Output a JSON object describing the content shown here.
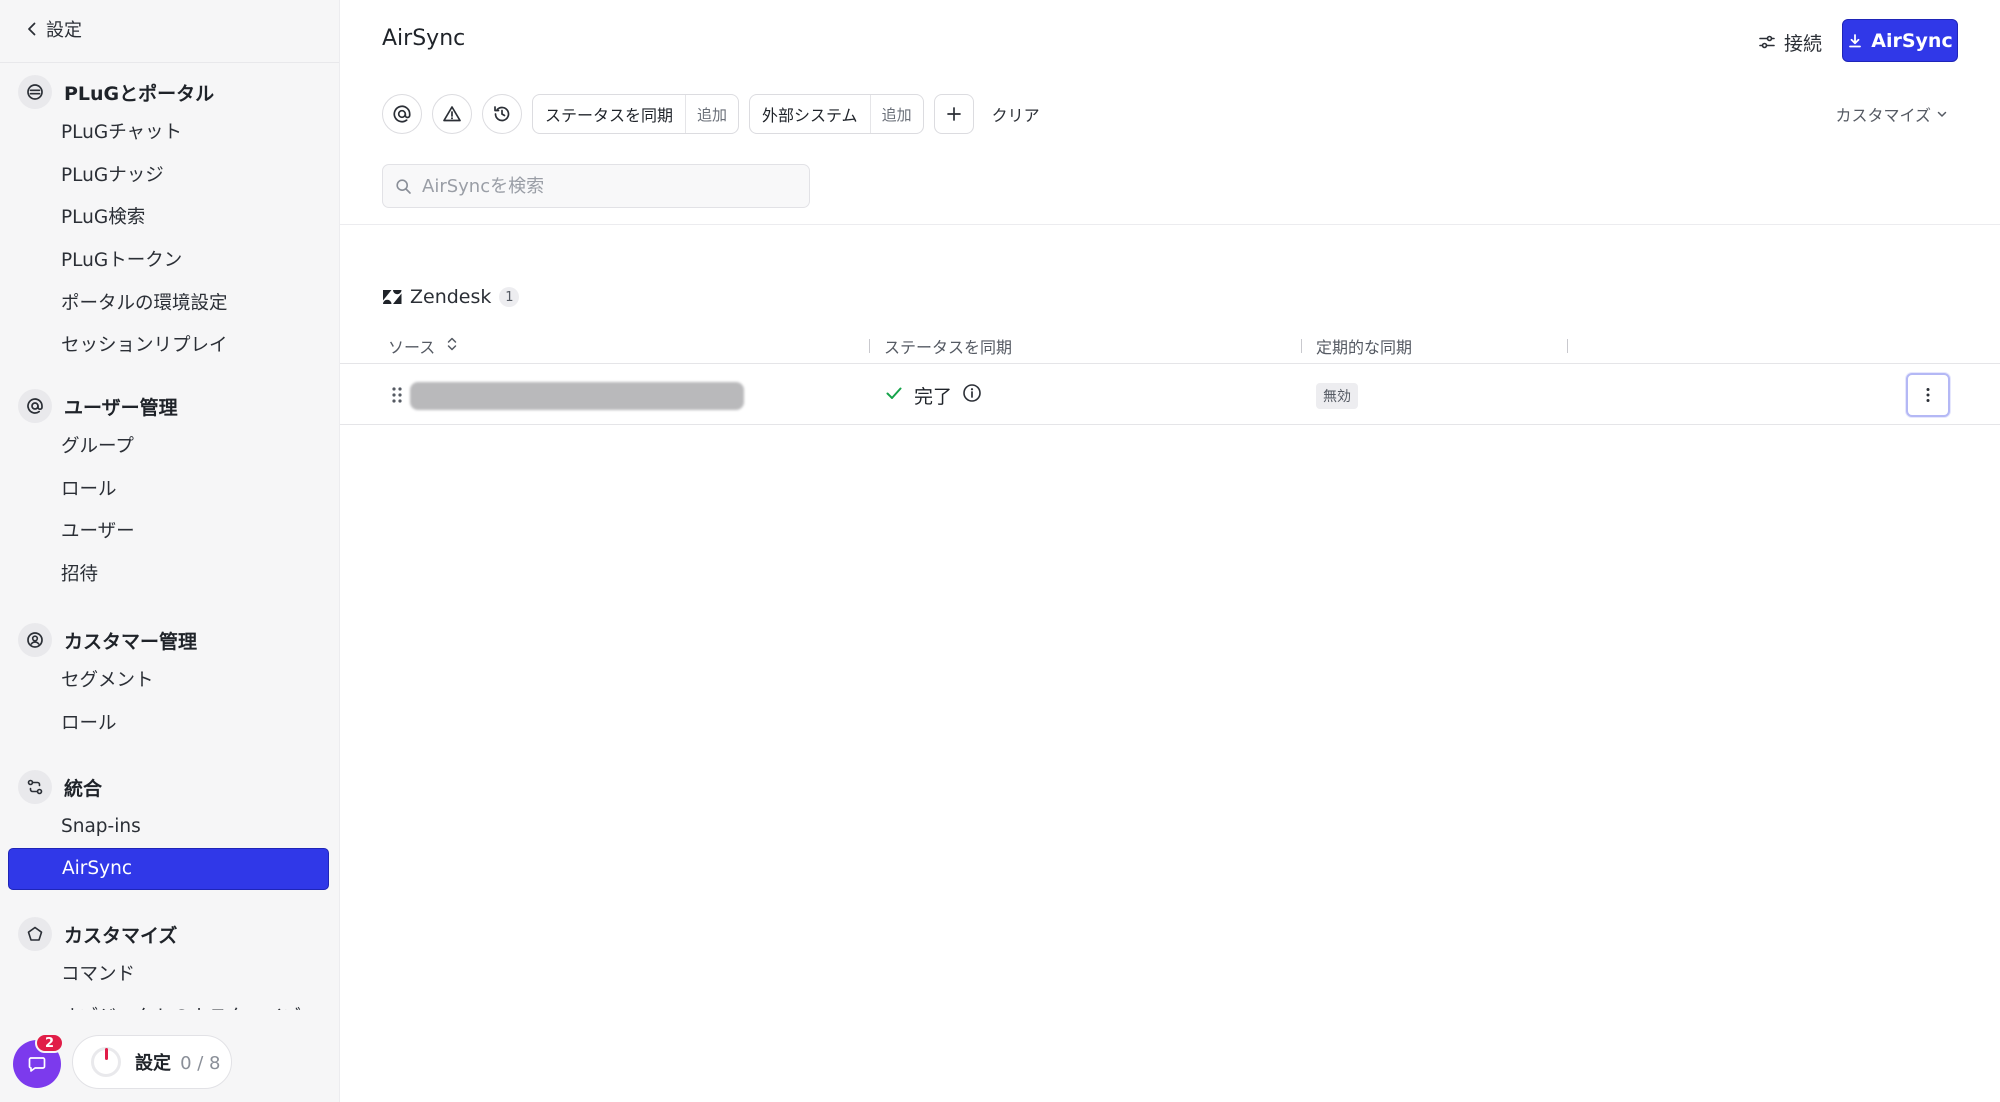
{
  "sidebar": {
    "back_label": "設定",
    "sections": [
      {
        "title": "PLuGとポータル",
        "icon": "portal-icon",
        "items": [
          "PLuGチャット",
          "PLuGナッジ",
          "PLuG検索",
          "PLuGトークン",
          "ポータルの環境設定",
          "セッションリプレイ"
        ]
      },
      {
        "title": "ユーザー管理",
        "icon": "at-sign-icon",
        "items": [
          "グループ",
          "ロール",
          "ユーザー",
          "招待"
        ]
      },
      {
        "title": "カスタマー管理",
        "icon": "customer-icon",
        "items": [
          "セグメント",
          "ロール"
        ]
      },
      {
        "title": "統合",
        "icon": "integration-icon",
        "items": [
          "Snap-ins",
          "AirSync"
        ]
      },
      {
        "title": "カスタマイズ",
        "icon": "pentagon-icon",
        "items": [
          "コマンド",
          "オブジェクトのカスタマイズ"
        ]
      }
    ],
    "active_item": "AirSync",
    "footer": {
      "chat_badge": "2",
      "setup_label": "設定",
      "setup_progress": "0 / 8"
    }
  },
  "header": {
    "title": "AirSync",
    "connect_label": "接続",
    "primary_button_label": "AirSync"
  },
  "filters": {
    "chips": [
      {
        "label": "ステータスを同期",
        "add_label": "追加"
      },
      {
        "label": "外部システム",
        "add_label": "追加"
      }
    ],
    "clear_label": "クリア",
    "customize_label": "カスタマイズ"
  },
  "search": {
    "placeholder": "AirSyncを検索",
    "value": ""
  },
  "group": {
    "name": "Zendesk",
    "count": "1"
  },
  "table": {
    "columns": [
      "ソース",
      "ステータスを同期",
      "定期的な同期"
    ],
    "rows": [
      {
        "source": "",
        "sync_status": "完了",
        "periodic_sync": "無効"
      }
    ]
  },
  "colors": {
    "accent": "#3038e8",
    "success": "#16a34a",
    "badge": "#e11d48",
    "chat": "#7c3aed"
  }
}
